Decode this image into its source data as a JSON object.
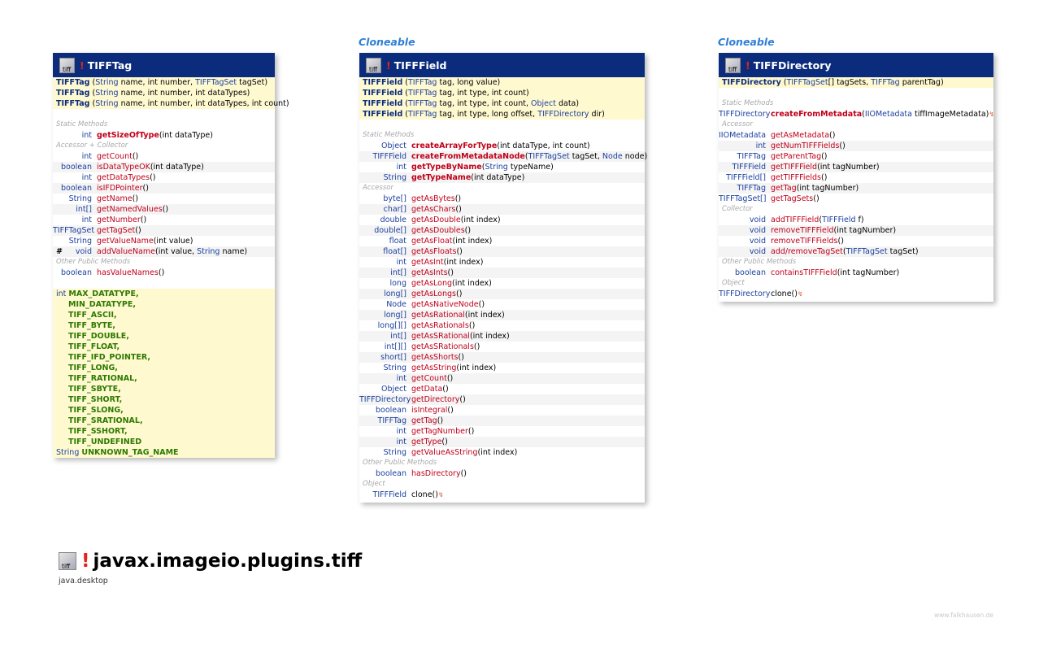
{
  "interfaces": {
    "field": "Cloneable",
    "directory": "Cloneable"
  },
  "tifftag": {
    "title": "TIFFTag",
    "constructors": [
      [
        [
          "TIFFTag",
          "b"
        ],
        [
          " (",
          ""
        ],
        [
          "String",
          "t"
        ],
        [
          " name, int number, ",
          ""
        ],
        [
          "TIFFTagSet",
          "t"
        ],
        [
          " tagSet)",
          ""
        ]
      ],
      [
        [
          "TIFFTag",
          "b"
        ],
        [
          " (",
          ""
        ],
        [
          "String",
          "t"
        ],
        [
          " name, int number, int dataTypes)",
          ""
        ]
      ],
      [
        [
          "TIFFTag",
          "b"
        ],
        [
          " (",
          ""
        ],
        [
          "String",
          "t"
        ],
        [
          " name, int number, int dataTypes, int count)",
          ""
        ]
      ]
    ],
    "sections": [
      {
        "label": "Static Methods",
        "rows": [
          {
            "type": "int",
            "name": "getSizeOfType",
            "static": true,
            "params": "(int dataType)"
          }
        ]
      },
      {
        "label": "Accessor + Collector",
        "rows": [
          {
            "type": "int",
            "name": "getCount",
            "params": "()"
          },
          {
            "type": "boolean",
            "name": "isDataTypeOK",
            "params": "(int dataType)"
          },
          {
            "type": "int",
            "name": "getDataTypes",
            "params": "()"
          },
          {
            "type": "boolean",
            "name": "isIFDPointer",
            "params": "()"
          },
          {
            "type": "String",
            "name": "getName",
            "params": "()"
          },
          {
            "type": "int[]",
            "name": "getNamedValues",
            "params": "()"
          },
          {
            "type": "int",
            "name": "getNumber",
            "params": "()"
          },
          {
            "type": "TIFFTagSet",
            "name": "getTagSet",
            "params": "()"
          },
          {
            "type": "String",
            "name": "getValueName",
            "params": "(int value)"
          },
          {
            "type": "#",
            "mod": "void",
            "name": "addValueName",
            "params": "(int value, String name)"
          }
        ]
      },
      {
        "label": "Other Public Methods",
        "rows": [
          {
            "type": "boolean",
            "name": "hasValueNames",
            "params": "()"
          }
        ]
      }
    ],
    "fields_type": "int",
    "fields": [
      "MAX_DATATYPE,",
      "MIN_DATATYPE,",
      "TIFF_ASCII,",
      "TIFF_BYTE,",
      "TIFF_DOUBLE,",
      "TIFF_FLOAT,",
      "TIFF_IFD_POINTER,",
      "TIFF_LONG,",
      "TIFF_RATIONAL,",
      "TIFF_SBYTE,",
      "TIFF_SHORT,",
      "TIFF_SLONG,",
      "TIFF_SRATIONAL,",
      "TIFF_SSHORT,",
      "TIFF_UNDEFINED"
    ],
    "extra_field_type": "String",
    "extra_field": "UNKNOWN_TAG_NAME"
  },
  "tifffield": {
    "title": "TIFFField",
    "constructors": [
      [
        [
          "TIFFField",
          "b"
        ],
        [
          " (",
          ""
        ],
        [
          "TIFFTag",
          "t"
        ],
        [
          " tag, long value)",
          ""
        ]
      ],
      [
        [
          "TIFFField",
          "b"
        ],
        [
          " (",
          ""
        ],
        [
          "TIFFTag",
          "t"
        ],
        [
          " tag, int type, int count)",
          ""
        ]
      ],
      [
        [
          "TIFFField",
          "b"
        ],
        [
          " (",
          ""
        ],
        [
          "TIFFTag",
          "t"
        ],
        [
          " tag, int type, int count, ",
          ""
        ],
        [
          "Object",
          "t"
        ],
        [
          " data)",
          ""
        ]
      ],
      [
        [
          "TIFFField",
          "b"
        ],
        [
          " (",
          ""
        ],
        [
          "TIFFTag",
          "t"
        ],
        [
          " tag, int type, long offset, ",
          ""
        ],
        [
          "TIFFDirectory",
          "t"
        ],
        [
          " dir)",
          ""
        ]
      ]
    ],
    "sections": [
      {
        "label": "Static Methods",
        "rows": [
          {
            "type": "Object",
            "name": "createArrayForType",
            "static": true,
            "params": "(int dataType, int count)"
          },
          {
            "type": "TIFFField",
            "name": "createFromMetadataNode",
            "static": true,
            "params": "(TIFFTagSet tagSet, Node node)"
          },
          {
            "type": "int",
            "name": "getTypeByName",
            "static": true,
            "params": "(String typeName)"
          },
          {
            "type": "String",
            "name": "getTypeName",
            "static": true,
            "params": "(int dataType)"
          }
        ]
      },
      {
        "label": "Accessor",
        "rows": [
          {
            "type": "byte[]",
            "name": "getAsBytes",
            "params": "()"
          },
          {
            "type": "char[]",
            "name": "getAsChars",
            "params": "()"
          },
          {
            "type": "double",
            "name": "getAsDouble",
            "params": "(int index)"
          },
          {
            "type": "double[]",
            "name": "getAsDoubles",
            "params": "()"
          },
          {
            "type": "float",
            "name": "getAsFloat",
            "params": "(int index)"
          },
          {
            "type": "float[]",
            "name": "getAsFloats",
            "params": "()"
          },
          {
            "type": "int",
            "name": "getAsInt",
            "params": "(int index)"
          },
          {
            "type": "int[]",
            "name": "getAsInts",
            "params": "()"
          },
          {
            "type": "long",
            "name": "getAsLong",
            "params": "(int index)"
          },
          {
            "type": "long[]",
            "name": "getAsLongs",
            "params": "()"
          },
          {
            "type": "Node",
            "name": "getAsNativeNode",
            "params": "()"
          },
          {
            "type": "long[]",
            "name": "getAsRational",
            "params": "(int index)"
          },
          {
            "type": "long[][]",
            "name": "getAsRationals",
            "params": "()"
          },
          {
            "type": "int[]",
            "name": "getAsSRational",
            "params": "(int index)"
          },
          {
            "type": "int[][]",
            "name": "getAsSRationals",
            "params": "()"
          },
          {
            "type": "short[]",
            "name": "getAsShorts",
            "params": "()"
          },
          {
            "type": "String",
            "name": "getAsString",
            "params": "(int index)"
          },
          {
            "type": "int",
            "name": "getCount",
            "params": "()"
          },
          {
            "type": "Object",
            "name": "getData",
            "params": "()"
          },
          {
            "type": "TIFFDirectory",
            "name": "getDirectory",
            "params": "()"
          },
          {
            "type": "boolean",
            "name": "isIntegral",
            "params": "()"
          },
          {
            "type": "TIFFTag",
            "name": "getTag",
            "params": "()"
          },
          {
            "type": "int",
            "name": "getTagNumber",
            "params": "()"
          },
          {
            "type": "int",
            "name": "getType",
            "params": "()"
          },
          {
            "type": "String",
            "name": "getValueAsString",
            "params": "(int index)"
          }
        ]
      },
      {
        "label": "Other Public Methods",
        "rows": [
          {
            "type": "boolean",
            "name": "hasDirectory",
            "params": "()"
          }
        ]
      },
      {
        "label": "Object",
        "rows": [
          {
            "type": "TIFFField",
            "name": "clone",
            "plain": true,
            "params": "()",
            "override": "↯"
          }
        ]
      }
    ]
  },
  "tiffdirectory": {
    "title": "TIFFDirectory",
    "constructors": [
      [
        [
          "TIFFDirectory",
          "b"
        ],
        [
          " (",
          ""
        ],
        [
          "TIFFTagSet",
          "t"
        ],
        [
          "[] tagSets, ",
          ""
        ],
        [
          "TIFFTag",
          "t"
        ],
        [
          " parentTag)",
          ""
        ]
      ]
    ],
    "sections": [
      {
        "label": "Static Methods",
        "rows": [
          {
            "type": "TIFFDirectory",
            "name": "createFromMetadata",
            "static": true,
            "params": "(IIOMetadata tiffImageMetadata)",
            "override": "↯"
          }
        ]
      },
      {
        "label": "Accessor",
        "rows": [
          {
            "type": "IIOMetadata",
            "name": "getAsMetadata",
            "params": "()"
          },
          {
            "type": "int",
            "name": "getNumTIFFFields",
            "params": "()"
          },
          {
            "type": "TIFFTag",
            "name": "getParentTag",
            "params": "()"
          },
          {
            "type": "TIFFField",
            "name": "getTIFFField",
            "params": "(int tagNumber)"
          },
          {
            "type": "TIFFField[]",
            "name": "getTIFFFields",
            "params": "()"
          },
          {
            "type": "TIFFTag",
            "name": "getTag",
            "params": "(int tagNumber)"
          },
          {
            "type": "TIFFTagSet[]",
            "name": "getTagSets",
            "params": "()"
          }
        ]
      },
      {
        "label": "Collector",
        "rows": [
          {
            "type": "void",
            "name": "addTIFFField",
            "params": "(TIFFField f)"
          },
          {
            "type": "void",
            "name": "removeTIFFField",
            "params": "(int tagNumber)"
          },
          {
            "type": "void",
            "name": "removeTIFFFields",
            "params": "()"
          },
          {
            "type": "void",
            "name": "add/removeTagSet",
            "params": "(TIFFTagSet tagSet)"
          }
        ]
      },
      {
        "label": "Other Public Methods",
        "rows": [
          {
            "type": "boolean",
            "name": "containsTIFFField",
            "params": "(int tagNumber)"
          }
        ]
      },
      {
        "label": "Object",
        "rows": [
          {
            "type": "TIFFDirectory",
            "name": "clone",
            "plain": true,
            "params": "()",
            "override": "↯"
          }
        ]
      }
    ]
  },
  "footer": {
    "icon_text": "tiff",
    "package": "javax.imageio.plugins.tiff",
    "module": "java.desktop",
    "credit": "www.falkhausen.de"
  },
  "icons": {
    "package": "package-icon",
    "exclamation": "exclamation-icon",
    "override": "lightning-icon"
  },
  "colors": {
    "header_bg": "#0b2c7c",
    "constructor_bg": "#fff9d0",
    "method_name": "#c0001a",
    "field_name": "#2d7a00",
    "interface": "#2e7fd6"
  }
}
